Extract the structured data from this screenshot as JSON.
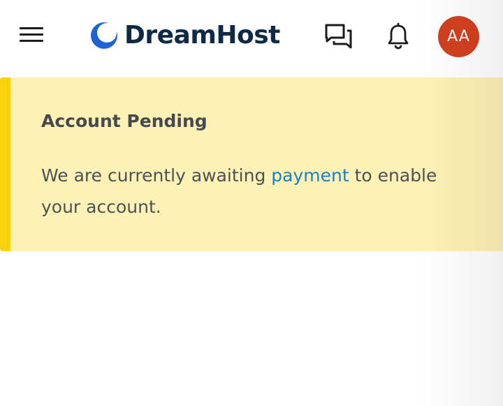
{
  "header": {
    "menu_icon": "hamburger-menu-icon",
    "logo": {
      "text": "DreamHost",
      "mark_icon": "crescent-moon-logo-icon",
      "colors": {
        "mark": "#1f62d6",
        "text": "#0e2a47"
      }
    },
    "chat_icon": "chat-bubbles-icon",
    "bell_icon": "bell-icon",
    "avatar": {
      "initials": "AA",
      "color": "#d2401f"
    }
  },
  "alert": {
    "title": "Account Pending",
    "body_before": "We are currently awaiting ",
    "link_text": "payment",
    "body_after": " to enable your account.",
    "colors": {
      "background": "#fdf1b5",
      "accent": "#f9d20e",
      "link": "#1b7fc4"
    }
  }
}
